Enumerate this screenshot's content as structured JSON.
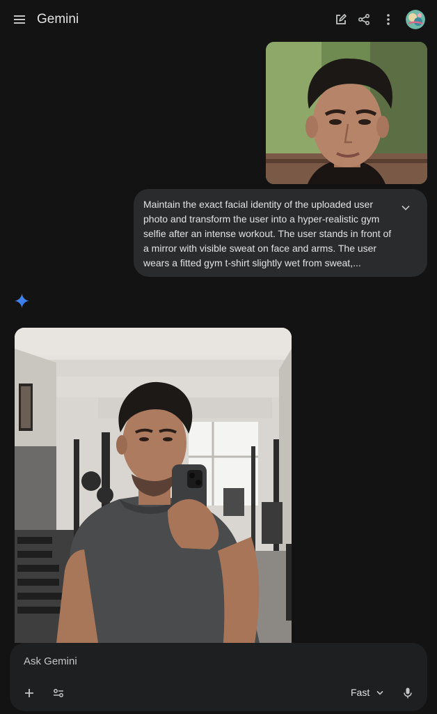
{
  "header": {
    "title": "Gemini",
    "menu_icon": "menu-icon",
    "new_chat_icon": "edit-icon",
    "share_icon": "share-icon",
    "more_icon": "more-vert-icon"
  },
  "conversation": {
    "user_image": "portrait-photo",
    "prompt_text": "Maintain the exact facial identity of the uploaded user photo and transform the user into a hyper-realistic gym selfie after an intense workout. The user stands in front of a mirror with visible sweat on face and arms. The user wears a fitted gym t-shirt slightly wet from sweat,...",
    "expand_icon": "chevron-down-icon",
    "response_icon": "gemini-spark-icon",
    "generated_image": "gym-mirror-selfie"
  },
  "composer": {
    "placeholder": "Ask Gemini",
    "add_icon": "plus-icon",
    "tools_icon": "tools-icon",
    "mode_label": "Fast",
    "mic_icon": "mic-icon"
  },
  "colors": {
    "background": "#131314",
    "bubble": "#2a2b2d",
    "composer": "#1e1f20",
    "accent": "#4285f4"
  }
}
